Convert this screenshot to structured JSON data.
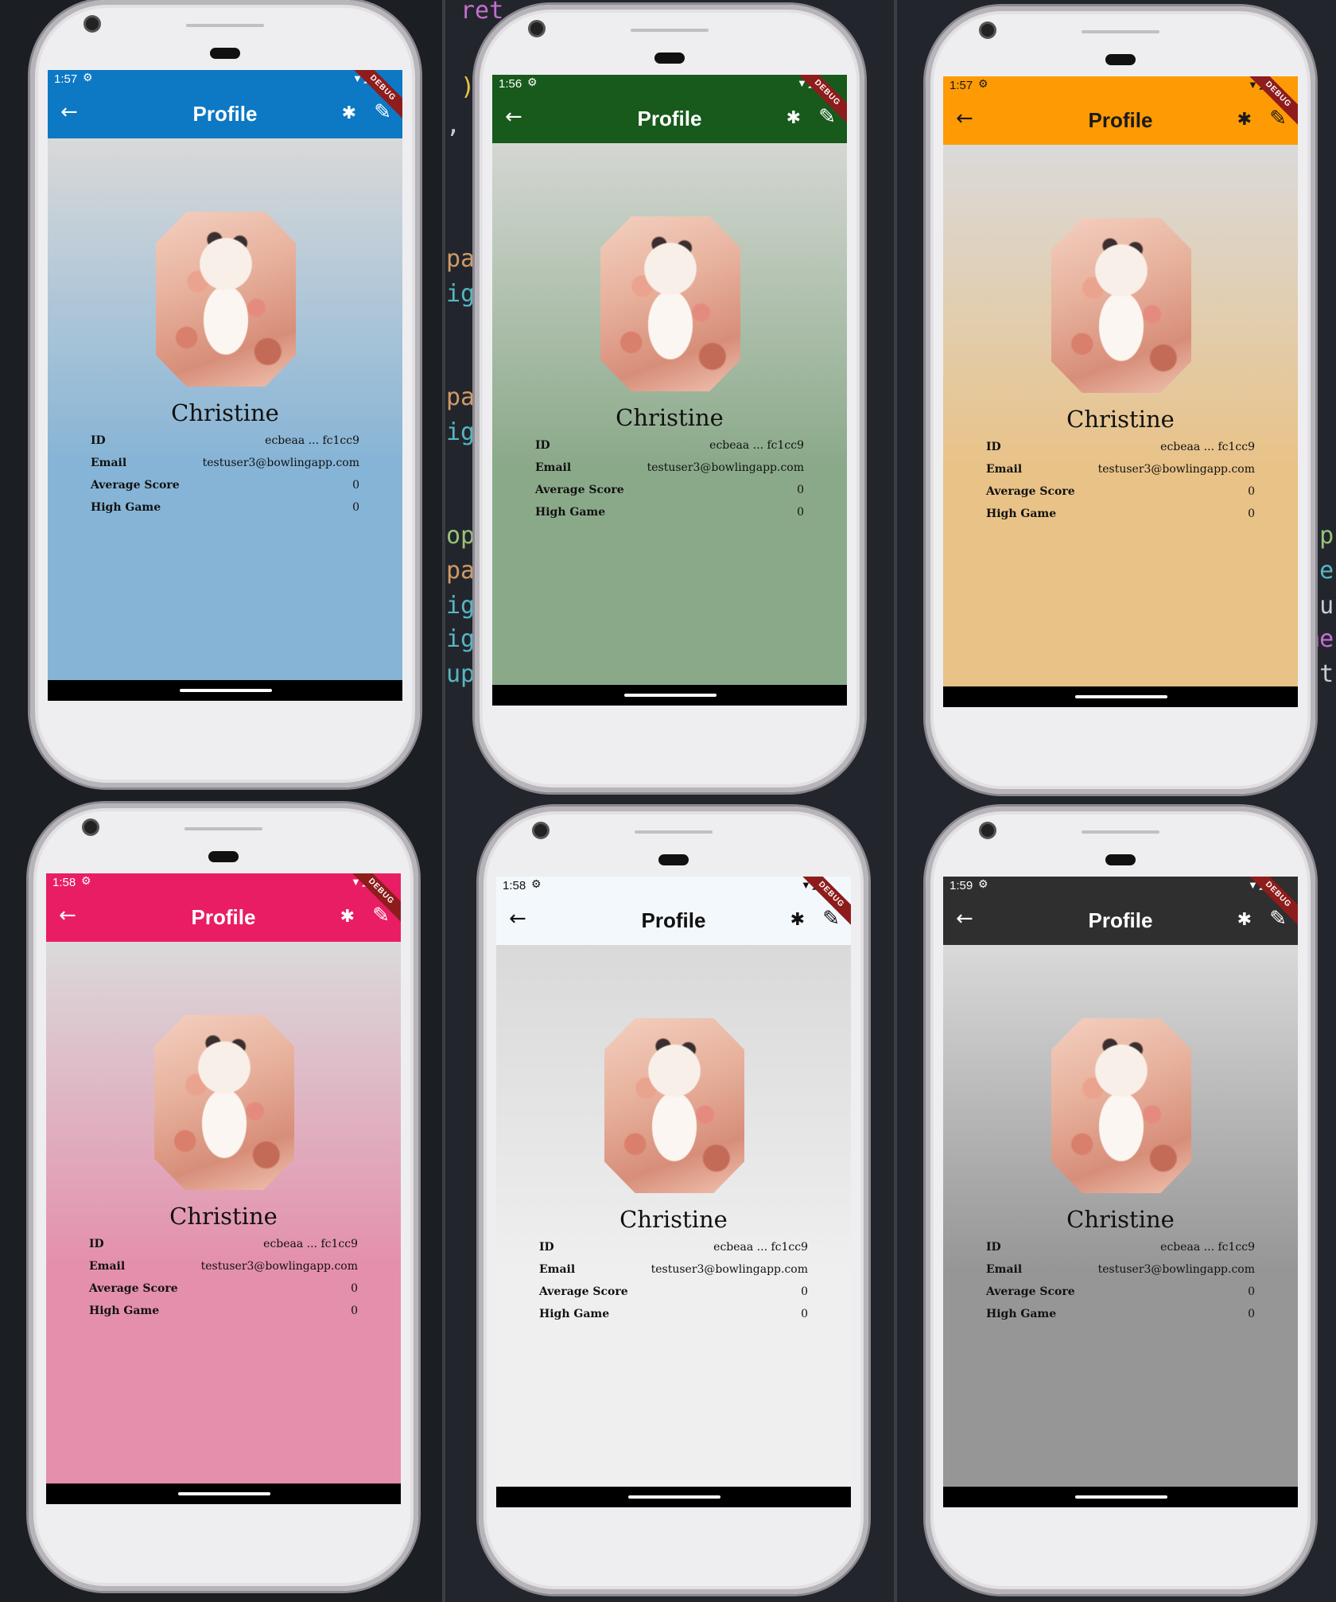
{
  "background_code": {
    "tokens": [
      "ret",
      ")",
      ",",
      "pa",
      "ig",
      "pa",
      "ig",
      "op",
      "pa",
      "ig",
      "ig",
      "up"
    ],
    "right_tokens": [
      "w p",
      "nte",
      "rou",
      "eme",
      "ont"
    ]
  },
  "profile": {
    "title": "Profile",
    "name": "Christine",
    "rows": [
      {
        "label": "ID",
        "value": "ecbeaa ... fc1cc9"
      },
      {
        "label": "Email",
        "value": "testuser3@bowlingapp.com"
      },
      {
        "label": "Average Score",
        "value": "0"
      },
      {
        "label": "High Game",
        "value": "0"
      }
    ],
    "debug_banner": "DEBUG"
  },
  "icons": {
    "back": "arrow-back-icon",
    "bug": "bug-icon",
    "edit": "edit-pencil-icon",
    "settings": "gear-icon",
    "signal": "wifi-signal-battery-icon"
  },
  "phones": [
    {
      "time": "1:57",
      "appbar_color": "#0d78c4",
      "appbar_text": "#ffffff",
      "bg_top": "#d9d9d9",
      "bg_bottom": "#86b4d6"
    },
    {
      "time": "1:56",
      "appbar_color": "#175a1b",
      "appbar_text": "#ffffff",
      "bg_top": "#d4d7d2",
      "bg_bottom": "#8aa989"
    },
    {
      "time": "1:57",
      "appbar_color": "#fd9a04",
      "appbar_text": "#1a1a1a",
      "bg_top": "#dadada",
      "bg_bottom": "#e9c287"
    },
    {
      "time": "1:58",
      "appbar_color": "#e91d63",
      "appbar_text": "#ffffff",
      "bg_top": "#dadada",
      "bg_bottom": "#e48fab"
    },
    {
      "time": "1:58",
      "appbar_color": "#f3f8fc",
      "appbar_text": "#111111",
      "bg_top": "#d9d9d9",
      "bg_bottom": "#efefef"
    },
    {
      "time": "1:59",
      "appbar_color": "#2f2f2f",
      "appbar_text": "#ffffff",
      "bg_top": "#d9d9d9",
      "bg_bottom": "#969696"
    }
  ]
}
